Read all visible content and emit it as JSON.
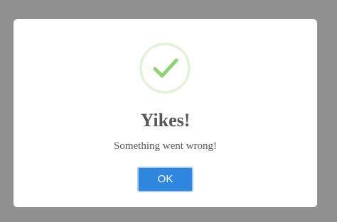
{
  "dialog": {
    "icon": "checkmark-icon",
    "title": "Yikes!",
    "message": "Something went wrong!",
    "ok_label": "OK"
  },
  "colors": {
    "overlay": "#909090",
    "dialog_background": "#ffffff",
    "icon_ring": "#e4f2dc",
    "checkmark": "#8fd175",
    "text": "#555555",
    "button": "#2e86de",
    "button_border": "#a9cdf0"
  }
}
